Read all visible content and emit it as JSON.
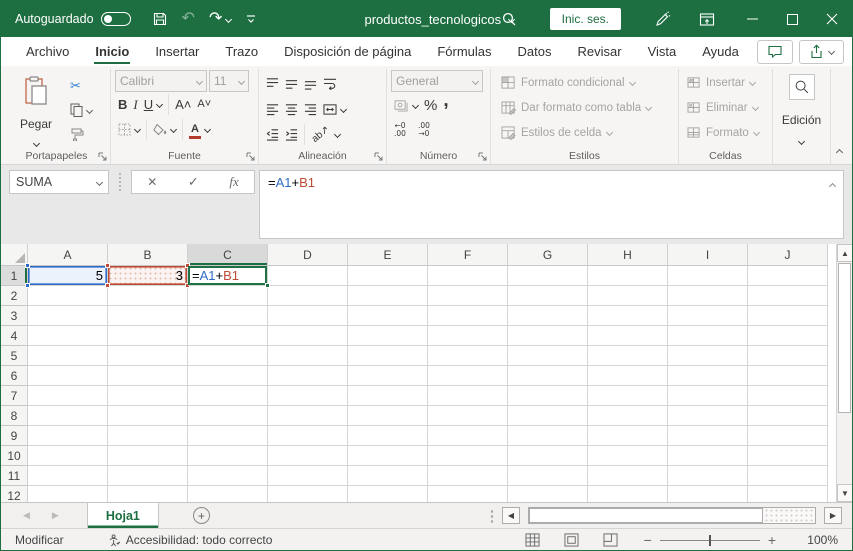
{
  "window": {
    "autosave_label": "Autoguardado",
    "doc_title": "productos_tecnologicos",
    "signin_label": "Inic. ses."
  },
  "ribbon": {
    "tabs": [
      "Archivo",
      "Inicio",
      "Insertar",
      "Trazo",
      "Disposición de página",
      "Fórmulas",
      "Datos",
      "Revisar",
      "Vista",
      "Ayuda"
    ],
    "active_tab": "Inicio",
    "clipboard": {
      "label": "Portapapeles",
      "paste_label": "Pegar"
    },
    "font": {
      "label": "Fuente",
      "font_name": "Calibri",
      "font_size": "11",
      "bold": "B",
      "italic": "I",
      "underline": "U"
    },
    "alignment": {
      "label": "Alineación"
    },
    "number": {
      "label": "Número",
      "format_value": "General",
      "percent": "%",
      "comma": ","
    },
    "styles": {
      "label": "Estilos",
      "items": [
        "Formato condicional",
        "Dar formato como tabla",
        "Estilos de celda"
      ]
    },
    "cells": {
      "label": "Celdas",
      "items": [
        "Insertar",
        "Eliminar",
        "Formato"
      ]
    },
    "editing": {
      "label": "Edición"
    }
  },
  "formula_bar": {
    "name_box_value": "SUMA",
    "fx_label": "fx",
    "formula_parts": [
      {
        "text": "=",
        "color": "#000000"
      },
      {
        "text": "A1",
        "color": "#2E6BC6"
      },
      {
        "text": "+",
        "color": "#000000"
      },
      {
        "text": "B1",
        "color": "#BE4B35"
      }
    ]
  },
  "grid": {
    "columns": [
      "A",
      "B",
      "C",
      "D",
      "E",
      "F",
      "G",
      "H",
      "I",
      "J"
    ],
    "visible_rows": 12,
    "active_column": "C",
    "active_row": "1",
    "cells": [
      {
        "ref": "A1",
        "value": "5",
        "align": "right",
        "highlight": "blue"
      },
      {
        "ref": "B1",
        "value": "3",
        "align": "right",
        "highlight": "red"
      },
      {
        "ref": "C1",
        "value": "=A1+B1",
        "align": "left",
        "highlight": "green",
        "colored_formula": true
      }
    ]
  },
  "sheet_bar": {
    "active_sheet": "Hoja1"
  },
  "status_bar": {
    "mode_label": "Modificar",
    "accessibility_label": "Accesibilidad: todo correcto",
    "zoom_level": "100%"
  },
  "colors": {
    "title_green": "#1D6F42",
    "ref_blue": "#2E6BC6",
    "ref_red": "#BE4B35",
    "selection_green": "#1E7145"
  }
}
